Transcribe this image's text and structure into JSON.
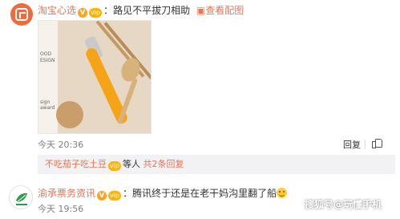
{
  "comment1": {
    "username": "淘宝心选",
    "separator": "：",
    "text": "路见不平拔刀相助",
    "view_image_link": "查看配图",
    "time": "今天 20:36",
    "reply_label": "回复"
  },
  "reply_summary": {
    "username": "不吃茄子吃土豆",
    "suffix": "等人",
    "count_link": "共2条回复"
  },
  "comment2": {
    "username": "渝承票务资讯",
    "separator": "：",
    "text": "腾讯终于还是在老干妈沟里翻了船",
    "time": "今天 19:56"
  },
  "watermark": "搜狐号@玩懂手机",
  "badges": {
    "verified": "V",
    "vip": "vip"
  },
  "photo_text": {
    "line1": "OOD",
    "line2": "ESIGN",
    "line3": "sign award"
  },
  "colors": {
    "accent_link": "#eb7350",
    "meta_gray": "#808080",
    "reply_bg": "#f2f2f5",
    "avatar_orange": "#ef6b3c"
  }
}
